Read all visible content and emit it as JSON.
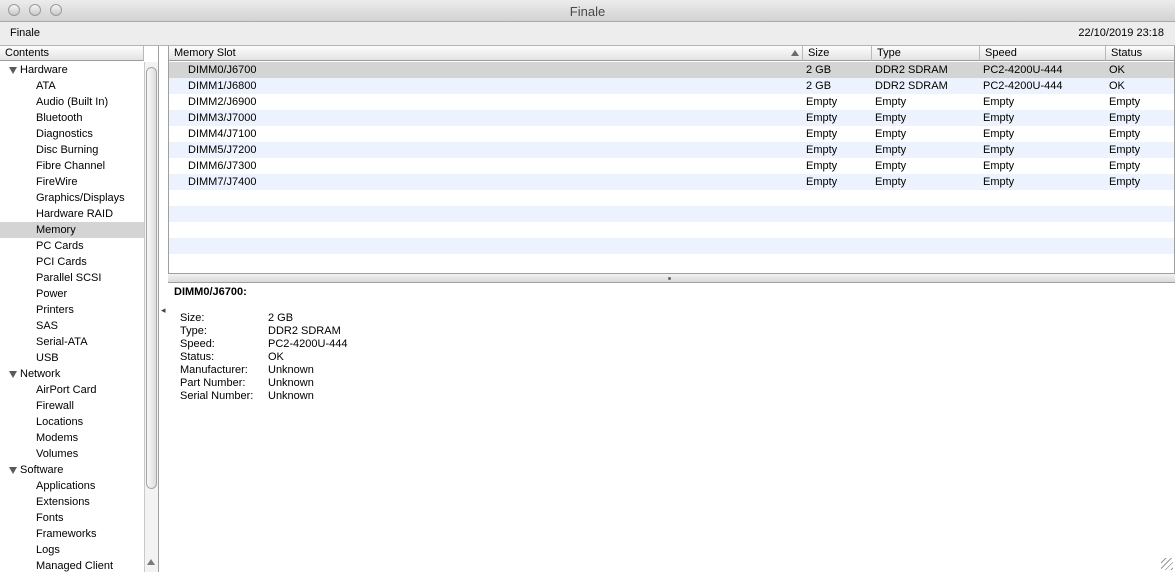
{
  "window": {
    "title": "Finale"
  },
  "header": {
    "computer_name": "Finale",
    "datetime": "22/10/2019 23:18"
  },
  "sidebar": {
    "column_header": "Contents",
    "items": [
      {
        "label": "Hardware",
        "level": "cat"
      },
      {
        "label": "ATA",
        "level": "child"
      },
      {
        "label": "Audio (Built In)",
        "level": "child"
      },
      {
        "label": "Bluetooth",
        "level": "child"
      },
      {
        "label": "Diagnostics",
        "level": "child"
      },
      {
        "label": "Disc Burning",
        "level": "child"
      },
      {
        "label": "Fibre Channel",
        "level": "child"
      },
      {
        "label": "FireWire",
        "level": "child"
      },
      {
        "label": "Graphics/Displays",
        "level": "child"
      },
      {
        "label": "Hardware RAID",
        "level": "child"
      },
      {
        "label": "Memory",
        "level": "child",
        "selected": true
      },
      {
        "label": "PC Cards",
        "level": "child"
      },
      {
        "label": "PCI Cards",
        "level": "child"
      },
      {
        "label": "Parallel SCSI",
        "level": "child"
      },
      {
        "label": "Power",
        "level": "child"
      },
      {
        "label": "Printers",
        "level": "child"
      },
      {
        "label": "SAS",
        "level": "child"
      },
      {
        "label": "Serial-ATA",
        "level": "child"
      },
      {
        "label": "USB",
        "level": "child"
      },
      {
        "label": "Network",
        "level": "cat"
      },
      {
        "label": "AirPort Card",
        "level": "child"
      },
      {
        "label": "Firewall",
        "level": "child"
      },
      {
        "label": "Locations",
        "level": "child"
      },
      {
        "label": "Modems",
        "level": "child"
      },
      {
        "label": "Volumes",
        "level": "child"
      },
      {
        "label": "Software",
        "level": "cat"
      },
      {
        "label": "Applications",
        "level": "child"
      },
      {
        "label": "Extensions",
        "level": "child"
      },
      {
        "label": "Fonts",
        "level": "child"
      },
      {
        "label": "Frameworks",
        "level": "child"
      },
      {
        "label": "Logs",
        "level": "child"
      },
      {
        "label": "Managed Client",
        "level": "child"
      }
    ]
  },
  "table": {
    "columns": [
      "Memory Slot",
      "Size",
      "Type",
      "Speed",
      "Status"
    ],
    "rows": [
      [
        "DIMM0/J6700",
        "2 GB",
        "DDR2 SDRAM",
        "PC2-4200U-444",
        "OK"
      ],
      [
        "DIMM1/J6800",
        "2 GB",
        "DDR2 SDRAM",
        "PC2-4200U-444",
        "OK"
      ],
      [
        "DIMM2/J6900",
        "Empty",
        "Empty",
        "Empty",
        "Empty"
      ],
      [
        "DIMM3/J7000",
        "Empty",
        "Empty",
        "Empty",
        "Empty"
      ],
      [
        "DIMM4/J7100",
        "Empty",
        "Empty",
        "Empty",
        "Empty"
      ],
      [
        "DIMM5/J7200",
        "Empty",
        "Empty",
        "Empty",
        "Empty"
      ],
      [
        "DIMM6/J7300",
        "Empty",
        "Empty",
        "Empty",
        "Empty"
      ],
      [
        "DIMM7/J7400",
        "Empty",
        "Empty",
        "Empty",
        "Empty"
      ]
    ],
    "selected_row": 0
  },
  "detail": {
    "title": "DIMM0/J6700:",
    "fields": [
      {
        "key": "Size:",
        "value": "2 GB"
      },
      {
        "key": "Type:",
        "value": "DDR2 SDRAM"
      },
      {
        "key": "Speed:",
        "value": "PC2-4200U-444"
      },
      {
        "key": "Status:",
        "value": "OK"
      },
      {
        "key": "Manufacturer:",
        "value": "Unknown"
      },
      {
        "key": "Part Number:",
        "value": "Unknown"
      },
      {
        "key": "Serial Number:",
        "value": "Unknown"
      }
    ]
  }
}
